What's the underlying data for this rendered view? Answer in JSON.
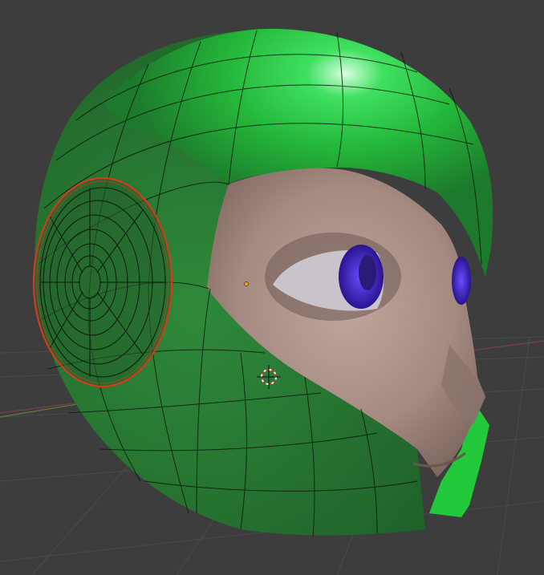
{
  "viewport": {
    "background_color": "#3d3d3d",
    "grid_line_color": "#4a4a4a",
    "x_axis_color": "#a0464f",
    "y_axis_color": "#6f8a34"
  },
  "model": {
    "helmet_color": "#2f8f3a",
    "helmet_highlight_color": "#2ecc40",
    "face_color": "#a89088",
    "eye_iris_color": "#4b2bd6",
    "wire_color": "#0b1a0b",
    "selection_edge_color": "#d23a1e"
  },
  "scene_objects": {
    "origin_dot": "origin-point",
    "cursor": "3d-cursor"
  }
}
